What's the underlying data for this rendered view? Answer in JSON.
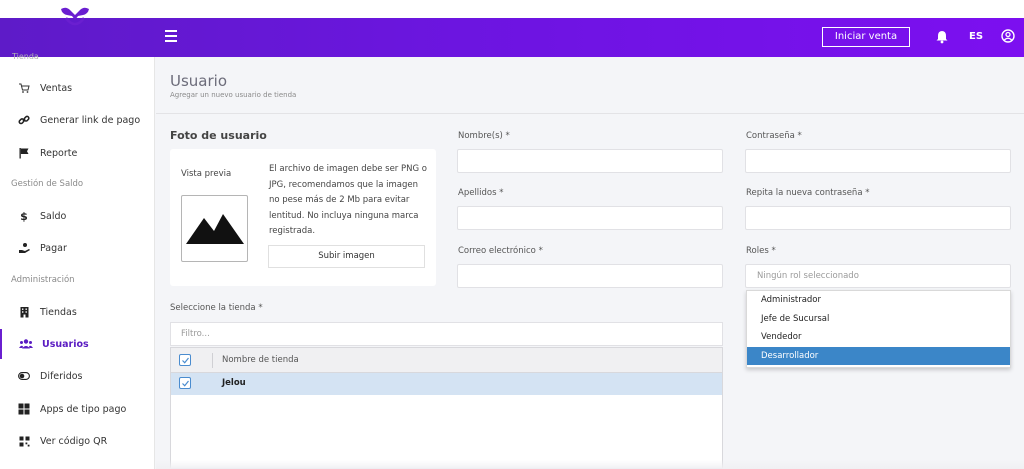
{
  "header": {
    "iniciar_venta_label": "Iniciar venta",
    "language": "ES"
  },
  "sidebar": {
    "top_section_label": "Tienda",
    "items_tienda": [
      {
        "label": "Ventas",
        "icon": "cart-icon"
      },
      {
        "label": "Generar link de pago",
        "icon": "link-icon"
      },
      {
        "label": "Reporte",
        "icon": "flag-icon"
      }
    ],
    "section_saldo": "Gestión de Saldo",
    "items_saldo": [
      {
        "label": "Saldo",
        "icon": "dollar-icon"
      },
      {
        "label": "Pagar",
        "icon": "hand-coin-icon"
      }
    ],
    "section_admin": "Administración",
    "items_admin": [
      {
        "label": "Tiendas",
        "icon": "building-icon"
      },
      {
        "label": "Usuarios",
        "icon": "users-icon",
        "active": true
      },
      {
        "label": "Diferidos",
        "icon": "toggle-icon"
      },
      {
        "label": "Apps de tipo pago",
        "icon": "grid-icon"
      },
      {
        "label": "Ver código QR",
        "icon": "qr-icon"
      }
    ]
  },
  "page": {
    "title": "Usuario",
    "subtitle": "Agregar un nuevo usuario de tienda"
  },
  "foto": {
    "title": "Foto de usuario",
    "preview_label": "Vista previa",
    "description": "El archivo de imagen debe ser PNG o JPG, recomendamos que la imagen no pese más de 2 Mb para evitar lentitud. No incluya ninguna marca registrada.",
    "upload_label": "Subir imagen"
  },
  "form": {
    "nombres_label": "Nombre(s) *",
    "nombres_value": "",
    "apellidos_label": "Apellidos *",
    "apellidos_value": "",
    "correo_label": "Correo electrónico *",
    "correo_value": "",
    "password_label": "Contraseña *",
    "password_value": "",
    "repeat_password_label": "Repita la nueva contraseña *",
    "repeat_password_value": "",
    "roles_label": "Roles *",
    "roles_placeholder": "Ningún rol seleccionado",
    "roles_options": [
      "Administrador",
      "Jefe de Sucursal",
      "Vendedor",
      "Desarrollador"
    ],
    "roles_highlighted": "Desarrollador"
  },
  "tienda": {
    "label": "Seleccione la tienda *",
    "filter_placeholder": "Filtro...",
    "column_header": "Nombre de tienda",
    "rows": [
      {
        "name": "Jelou",
        "checked": true
      }
    ],
    "header_checked": true
  },
  "colors": {
    "header_gradient_start": "#5e1bc8",
    "header_gradient_end": "#7c0ff0",
    "accent": "#6a1fd0",
    "selected_option": "#3b86c8",
    "selected_row": "#d4e3f3"
  }
}
